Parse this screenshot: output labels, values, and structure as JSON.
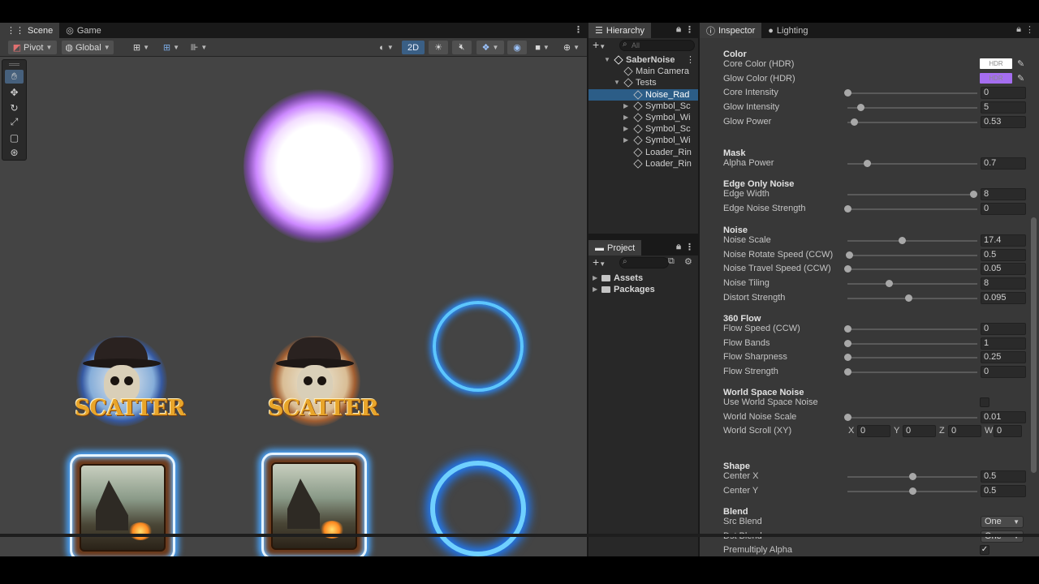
{
  "scene": {
    "tabs": [
      {
        "label": "Scene",
        "icon": "grid-icon"
      },
      {
        "label": "Game",
        "icon": "gamepad-icon"
      }
    ],
    "toolbar": {
      "pivot": "Pivot",
      "global": "Global",
      "mode_2d": "2D"
    },
    "sprites": {
      "scatter_text": "SCATTER"
    }
  },
  "hierarchy": {
    "tab": "Hierarchy",
    "search_placeholder": "All",
    "items": [
      {
        "label": "SaberNoise",
        "depth": 0,
        "expanded": true
      },
      {
        "label": "Main Camera",
        "depth": 1
      },
      {
        "label": "Tests",
        "depth": 1,
        "expanded": true
      },
      {
        "label": "Noise_Rad",
        "depth": 2,
        "selected": true
      },
      {
        "label": "Symbol_Sc",
        "depth": 2,
        "collapsed": true
      },
      {
        "label": "Symbol_Wi",
        "depth": 2,
        "collapsed": true
      },
      {
        "label": "Symbol_Sc",
        "depth": 2,
        "collapsed": true
      },
      {
        "label": "Symbol_Wi",
        "depth": 2,
        "collapsed": true
      },
      {
        "label": "Loader_Rin",
        "depth": 2
      },
      {
        "label": "Loader_Rin",
        "depth": 2
      }
    ]
  },
  "project": {
    "tab": "Project",
    "folders": [
      "Assets",
      "Packages"
    ]
  },
  "inspector": {
    "tabs": [
      "Inspector",
      "Lighting"
    ],
    "sections": [
      {
        "header": "Color",
        "props": [
          {
            "label": "Core Color (HDR)",
            "type": "color",
            "color": "#ffffff",
            "badge": "HDR"
          },
          {
            "label": "Glow Color (HDR)",
            "type": "color",
            "color": "#a56ef0",
            "badge": "HDR"
          },
          {
            "label": "Core Intensity",
            "type": "slider",
            "value": "0",
            "pos": 0.0
          },
          {
            "label": "Glow Intensity",
            "type": "slider",
            "value": "5",
            "pos": 0.1
          },
          {
            "label": "Glow Power",
            "type": "slider",
            "value": "0.53",
            "pos": 0.05
          }
        ]
      },
      {
        "header": "Mask",
        "props": [
          {
            "label": "Alpha Power",
            "type": "slider",
            "value": "0.7",
            "pos": 0.15
          }
        ]
      },
      {
        "header": "Edge Only Noise",
        "props": [
          {
            "label": "Edge Width",
            "type": "slider",
            "value": "8",
            "pos": 0.97
          },
          {
            "label": "Edge Noise Strength",
            "type": "slider",
            "value": "0",
            "pos": 0.0
          }
        ]
      },
      {
        "header": "Noise",
        "props": [
          {
            "label": "Noise Scale",
            "type": "slider",
            "value": "17.4",
            "pos": 0.42
          },
          {
            "label": "Noise Rotate Speed (CCW)",
            "type": "slider",
            "value": "0.5",
            "pos": 0.01
          },
          {
            "label": "Noise Travel Speed (CCW)",
            "type": "slider",
            "value": "0.05",
            "pos": 0.0
          },
          {
            "label": "Noise Tiling",
            "type": "slider",
            "value": "8",
            "pos": 0.32
          },
          {
            "label": "Distort Strength",
            "type": "slider",
            "value": "0.095",
            "pos": 0.47
          }
        ]
      },
      {
        "header": "360 Flow",
        "props": [
          {
            "label": "Flow Speed (CCW)",
            "type": "slider",
            "value": "0",
            "pos": 0.0
          },
          {
            "label": "Flow Bands",
            "type": "slider",
            "value": "1",
            "pos": 0.0
          },
          {
            "label": "Flow Sharpness",
            "type": "slider",
            "value": "0.25",
            "pos": 0.0
          },
          {
            "label": "Flow Strength",
            "type": "slider",
            "value": "0",
            "pos": 0.0
          }
        ]
      },
      {
        "header": "World Space Noise",
        "props": [
          {
            "label": "Use World Space Noise",
            "type": "checkbox",
            "checked": false
          },
          {
            "label": "World Noise Scale",
            "type": "slider",
            "value": "0.01",
            "pos": 0.0
          },
          {
            "label": "World Scroll (XY)",
            "type": "vector4",
            "values": [
              {
                "axis": "X",
                "value": "0"
              },
              {
                "axis": "Y",
                "value": "0"
              },
              {
                "axis": "Z",
                "value": "0"
              },
              {
                "axis": "W",
                "value": "0"
              }
            ]
          }
        ]
      },
      {
        "header": "Shape",
        "props": [
          {
            "label": "Center X",
            "type": "slider",
            "value": "0.5",
            "pos": 0.5
          },
          {
            "label": "Center Y",
            "type": "slider",
            "value": "0.5",
            "pos": 0.5
          }
        ]
      },
      {
        "header": "Blend",
        "props": [
          {
            "label": "Src Blend",
            "type": "dropdown",
            "value": "One"
          },
          {
            "label": "Dst Blend",
            "type": "dropdown",
            "value": "One"
          },
          {
            "label": "Premultiply Alpha",
            "type": "checkbox",
            "checked": true
          }
        ]
      }
    ]
  }
}
